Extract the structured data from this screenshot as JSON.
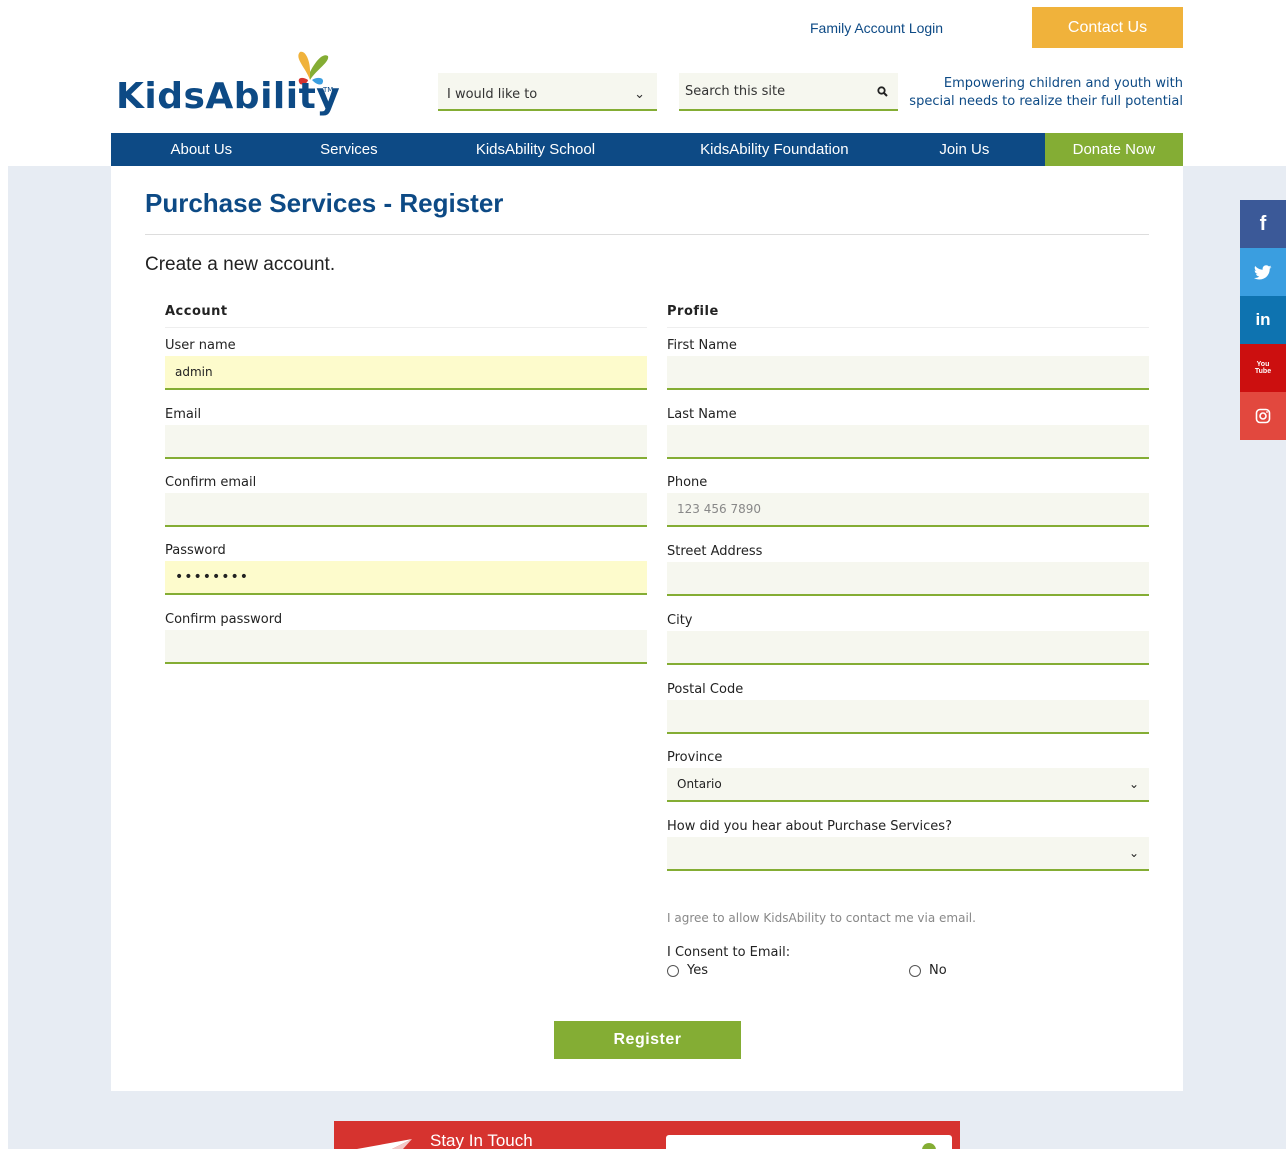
{
  "header": {
    "family_login": "Family Account Login",
    "contact": "Contact Us",
    "logo_text": "KidsAbility",
    "logo_tm": "TM",
    "like_select": "I would like to",
    "search_placeholder": "Search this site",
    "tagline_1": "Empowering children and youth with",
    "tagline_2": "special needs to realize their full potential"
  },
  "nav": {
    "items": [
      "About Us",
      "Services",
      "KidsAbility School",
      "KidsAbility Foundation",
      "Join Us",
      "Donate Now"
    ]
  },
  "page": {
    "title": "Purchase Services - Register",
    "subtitle": "Create a new account."
  },
  "account": {
    "heading": "Account",
    "username_label": "User name",
    "username_value": "admin",
    "email_label": "Email",
    "email_value": "",
    "confirm_email_label": "Confirm email",
    "confirm_email_value": "",
    "password_label": "Password",
    "password_value": "••••••••",
    "confirm_password_label": "Confirm password",
    "confirm_password_value": ""
  },
  "profile": {
    "heading": "Profile",
    "first_name_label": "First Name",
    "first_name_value": "",
    "last_name_label": "Last Name",
    "last_name_value": "",
    "phone_label": "Phone",
    "phone_placeholder": "123 456 7890",
    "street_label": "Street Address",
    "street_value": "",
    "city_label": "City",
    "city_value": "",
    "postal_label": "Postal Code",
    "postal_value": "",
    "province_label": "Province",
    "province_value": "Ontario",
    "hear_label": "How did you hear about Purchase Services?",
    "hear_value": "",
    "agree_text": "I agree to allow KidsAbility to contact me via email.",
    "consent_label": "I Consent to Email:",
    "consent_yes": "Yes",
    "consent_no": "No"
  },
  "register_label": "Register",
  "social": {
    "facebook": "f",
    "linkedin": "in",
    "youtube": "You Tube"
  },
  "footer": {
    "stay_in_touch": "Stay In Touch"
  },
  "colors": {
    "brand_blue": "#0d4a85",
    "accent_green": "#84ad34",
    "contact_orange": "#f0b23b",
    "facebook": "#3b5998",
    "twitter": "#3a9ee0",
    "linkedin": "#0e73b0",
    "youtube": "#cc0f0f",
    "instagram": "#e2483e"
  }
}
